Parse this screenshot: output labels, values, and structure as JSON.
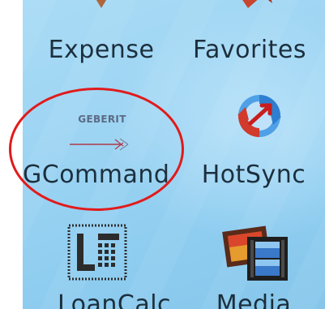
{
  "apps": [
    {
      "key": "expense",
      "label": "Expense"
    },
    {
      "key": "favorites",
      "label": "Favorites"
    },
    {
      "key": "gcommand",
      "label": "GCommand",
      "icon_text": "GEBERIT"
    },
    {
      "key": "hotsync",
      "label": "HotSync"
    },
    {
      "key": "loancalc",
      "label": "LoanCalc"
    },
    {
      "key": "media",
      "label": "Media"
    }
  ],
  "colors": {
    "wallpaper": "#9ed5f3",
    "label_text": "#1c2f3d",
    "highlight_circle": "#e11b1b"
  },
  "icons": {
    "expense": "expense-icon",
    "favorites": "favorites-icon",
    "gcommand": "geberit-logo-icon",
    "hotsync": "hotsync-icon",
    "loancalc": "calculator-icon",
    "media": "media-icon"
  }
}
